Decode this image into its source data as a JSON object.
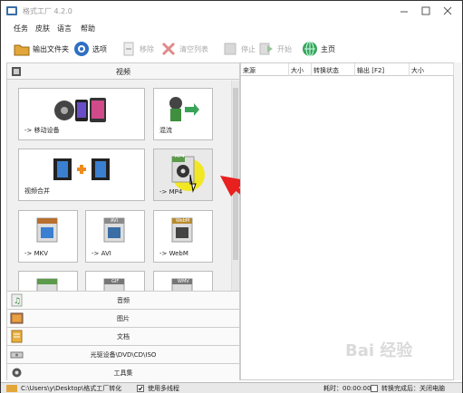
{
  "window": {
    "title": "格式工厂 4.2.0"
  },
  "menu": [
    "任务",
    "皮肤",
    "语言",
    "帮助"
  ],
  "toolbar": {
    "output_folder": "输出文件夹",
    "options": "选项",
    "remove": "移除",
    "clear_list": "清空列表",
    "stop": "停止",
    "start": "开始",
    "home": "主页"
  },
  "left": {
    "video_header": "视频",
    "tiles": [
      {
        "label": "-> 移动设备"
      },
      {
        "label": "混流"
      },
      {
        "label": "视频合并"
      },
      {
        "label": "-> MP4",
        "badge": "MP4"
      },
      {
        "label": "-> MKV"
      },
      {
        "label": "-> AVI",
        "badge": "AVI"
      },
      {
        "label": "-> WebM",
        "badge": "WebM"
      },
      {
        "label": ""
      },
      {
        "label": "",
        "badge": "GIF"
      },
      {
        "label": "",
        "badge": "WMV"
      }
    ],
    "categories": [
      "音频",
      "图片",
      "文档",
      "光驱设备\\DVD\\CD\\ISO",
      "工具集"
    ]
  },
  "table": {
    "columns": [
      "来源",
      "大小",
      "转换状态",
      "输出 [F2]",
      "大小"
    ]
  },
  "status": {
    "path": "C:\\Users\\y\\Desktop\\格式工厂转化",
    "multithread": "使用多线程",
    "elapsed": "耗时：00:00:00",
    "shutdown": "转换完成后：关闭电脑"
  },
  "watermark": "Bai 经验",
  "colors": {
    "accent_red": "#e8201f",
    "highlight_yellow": "#f3e600"
  }
}
